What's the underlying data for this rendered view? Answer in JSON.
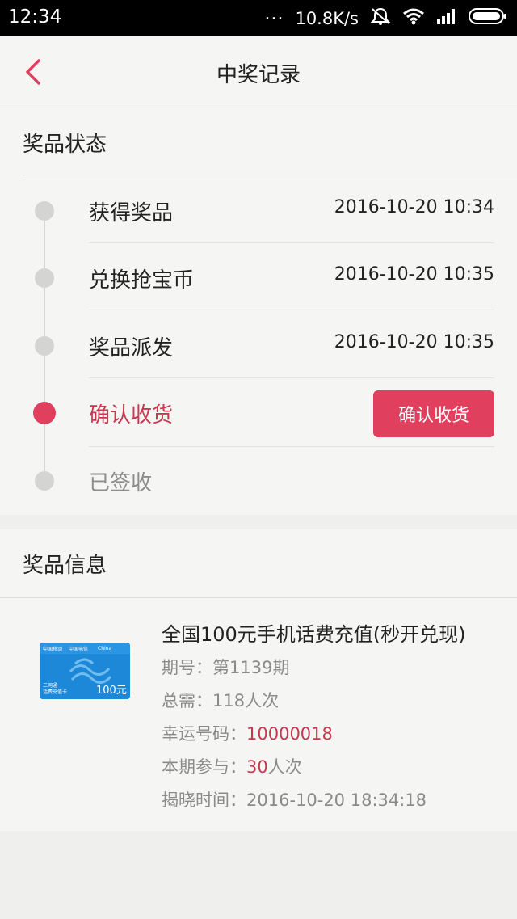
{
  "status_bar": {
    "time": "12:34",
    "dots": "...",
    "speed": "10.8K/s"
  },
  "nav": {
    "title": "中奖记录"
  },
  "prize_status": {
    "title": "奖品状态",
    "steps": [
      {
        "label": "获得奖品",
        "time": "2016-10-20 10:34"
      },
      {
        "label": "兑换抢宝币",
        "time": "2016-10-20 10:35"
      },
      {
        "label": "奖品派发",
        "time": "2016-10-20 10:35"
      },
      {
        "label": "确认收货",
        "button": "确认收货"
      },
      {
        "label": "已签收"
      }
    ]
  },
  "prize_info": {
    "title": "奖品信息",
    "name": "全国100元手机话费充值(秒开兑现)",
    "period_label": "期号：",
    "period_value": "第1139期",
    "total_label": "总需：",
    "total_value": "118人次",
    "lucky_label": "幸运号码：",
    "lucky_value": "10000018",
    "participate_label": "本期参与：",
    "participate_value": "30",
    "participate_unit": "人次",
    "reveal_label": "揭晓时间：",
    "reveal_value": "2016-10-20 18:34:18",
    "card_amount": "100元",
    "card_brand_cmcc": "中国移动",
    "card_brand_telecom": "中国电信",
    "card_china": "China",
    "card_line1": "三网通",
    "card_line2": "话费充值卡"
  },
  "colors": {
    "accent": "#e0405e",
    "background": "#eff0ee",
    "card": "#f5f6f4"
  }
}
